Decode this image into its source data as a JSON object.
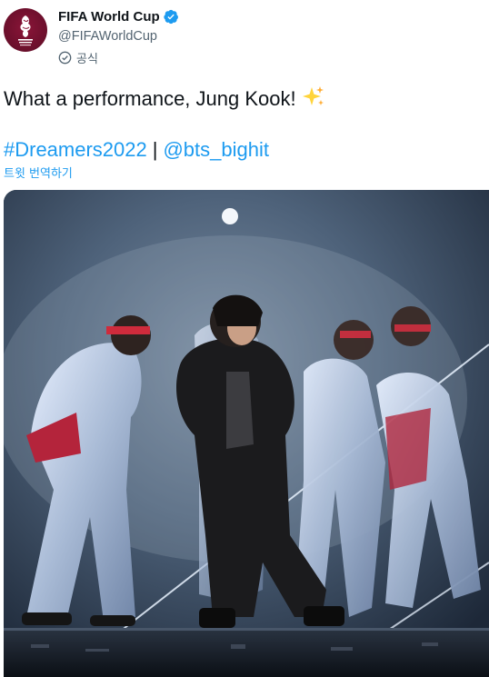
{
  "account": {
    "display_name": "FIFA World Cup",
    "handle": "@FIFAWorldCup",
    "official_label": "공식",
    "avatar_icon": "fifa-world-cup-qatar-2022-logo",
    "avatar_text": "FIFA WORLD CUP Qatar2022"
  },
  "tweet": {
    "text": "What a performance, Jung Kook!",
    "emoji_icon": "sparkles-icon",
    "hashtag": "#Dreamers2022",
    "separator": "|",
    "mention": "@bts_bighit",
    "translate_label": "트윗 번역하기"
  },
  "media": {
    "description_icon": "concert-stage-photo"
  },
  "colors": {
    "link": "#1d9bf0",
    "verified": "#1d9bf0",
    "secondary_text": "#536471",
    "avatar_bg": "#8a1538"
  }
}
